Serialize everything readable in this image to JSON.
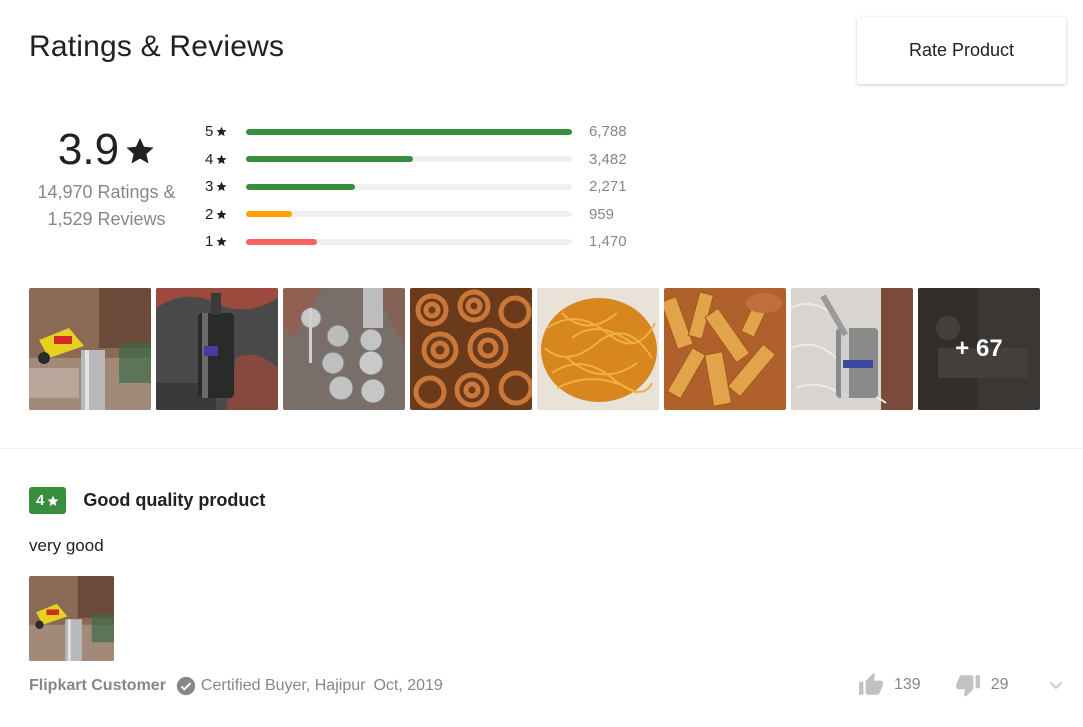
{
  "header": {
    "title": "Ratings & Reviews",
    "rate_button_label": "Rate Product"
  },
  "summary": {
    "average": "3.9",
    "ratings_text": "14,970 Ratings &",
    "reviews_text": "1,529 Reviews"
  },
  "distribution": [
    {
      "stars": "5",
      "count": "6,788",
      "fraction": 1.0,
      "color": "#388e3c"
    },
    {
      "stars": "4",
      "count": "3,482",
      "fraction": 0.513,
      "color": "#388e3c"
    },
    {
      "stars": "3",
      "count": "2,271",
      "fraction": 0.335,
      "color": "#388e3c"
    },
    {
      "stars": "2",
      "count": "959",
      "fraction": 0.141,
      "color": "#ff9f00"
    },
    {
      "stars": "1",
      "count": "1,470",
      "fraction": 0.217,
      "color": "#ff6161"
    }
  ],
  "photos": {
    "more_label": "+ 67"
  },
  "review": {
    "rating": "4",
    "title": "Good quality product",
    "body": "very good",
    "author": "Flipkart Customer",
    "certified_text": "Certified Buyer, Hajipur",
    "date": "Oct, 2019",
    "likes": "139",
    "dislikes": "29"
  },
  "colors": {
    "accent_green": "#388e3c",
    "muted_text": "#878787"
  }
}
